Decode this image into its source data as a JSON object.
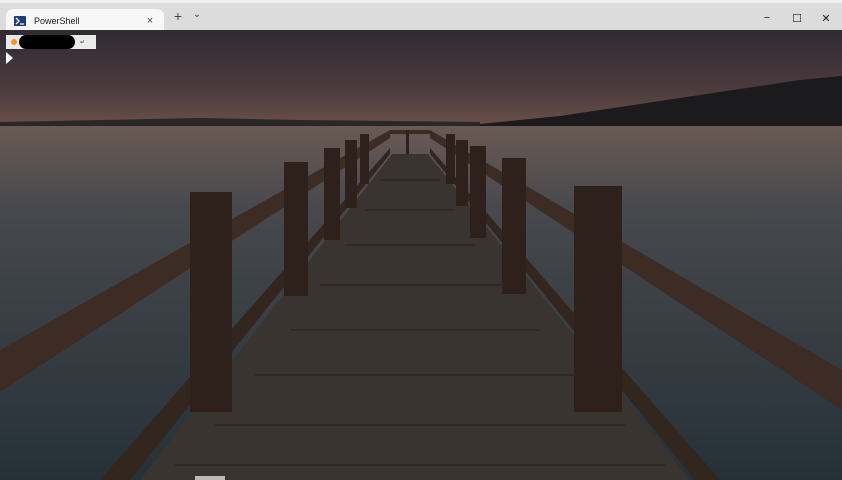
{
  "window": {
    "tab_title": "PowerShell",
    "tab_close_glyph": "×",
    "new_tab_glyph": "+",
    "dropdown_glyph": "⌄",
    "minimize_glyph": "−",
    "maximize_glyph": "☐",
    "close_glyph": "✕"
  },
  "terminal": {
    "background_image": "wooden pier on lake at dusk",
    "prompt": {
      "os_icon": "ubuntu-logo-icon",
      "user_redacted": true,
      "enter_glyph": "↵"
    },
    "cursor_glyph": "▶"
  },
  "colors": {
    "titlebar": "#dcdcdc",
    "tab": "#f7f7f7",
    "prompt_bg": "#eaeaea",
    "accent_orange": "#ff8f1f",
    "water": "#2e3b42",
    "sky_top": "#3a2f37",
    "sky_horizon": "#6a5048",
    "pier_wood": "#3c2c24"
  }
}
